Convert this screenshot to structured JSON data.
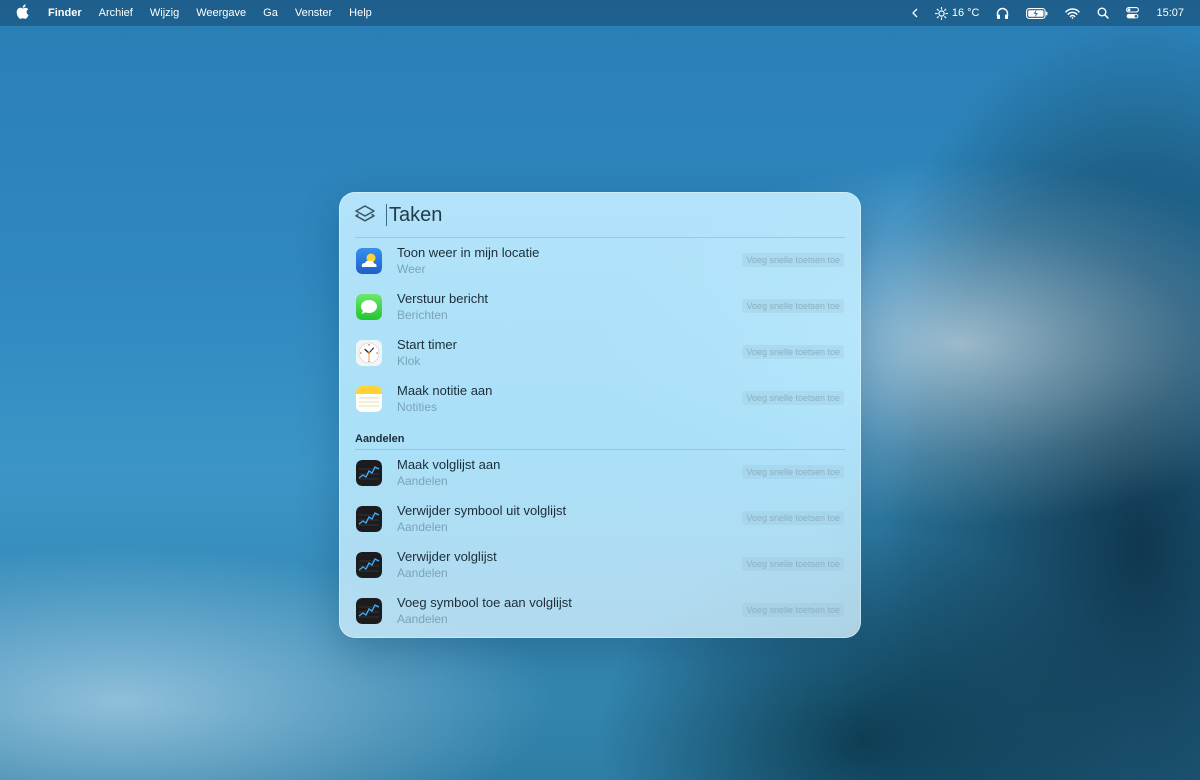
{
  "menubar": {
    "app_name": "Finder",
    "menus": [
      "Archief",
      "Wijzig",
      "Weergave",
      "Ga",
      "Venster",
      "Help"
    ],
    "weather": "16 °C",
    "clock": "15:07",
    "icons": [
      "apple-logo",
      "chevron-left-icon",
      "sun-icon",
      "headphones-icon",
      "battery-icon",
      "wifi-icon",
      "search-icon",
      "control-center-icon"
    ]
  },
  "spotlight": {
    "query": "Taken",
    "icon": "shortcuts-layers-icon",
    "results": [
      {
        "title": "Toon weer in mijn locatie",
        "subtitle": "Weer",
        "shortcut": "Voeg snelle toetsen toe",
        "icon": "weather-app-icon"
      },
      {
        "title": "Verstuur bericht",
        "subtitle": "Berichten",
        "shortcut": "Voeg snelle toetsen toe",
        "icon": "messages-app-icon"
      },
      {
        "title": "Start timer",
        "subtitle": "Klok",
        "shortcut": "Voeg snelle toetsen toe",
        "icon": "clock-app-icon"
      },
      {
        "title": "Maak notitie aan",
        "subtitle": "Notities",
        "shortcut": "Voeg snelle toetsen toe",
        "icon": "notes-app-icon"
      }
    ],
    "section_title": "Aandelen",
    "section_results": [
      {
        "title": "Maak volglijst aan",
        "subtitle": "Aandelen",
        "shortcut": "Voeg snelle toetsen toe",
        "icon": "stocks-app-icon"
      },
      {
        "title": "Verwijder symbool uit volglijst",
        "subtitle": "Aandelen",
        "shortcut": "Voeg snelle toetsen toe",
        "icon": "stocks-app-icon"
      },
      {
        "title": "Verwijder volglijst",
        "subtitle": "Aandelen",
        "shortcut": "Voeg snelle toetsen toe",
        "icon": "stocks-app-icon"
      },
      {
        "title": "Voeg symbool toe aan volglijst",
        "subtitle": "Aandelen",
        "shortcut": "Voeg snelle toetsen toe",
        "icon": "stocks-app-icon"
      }
    ]
  }
}
